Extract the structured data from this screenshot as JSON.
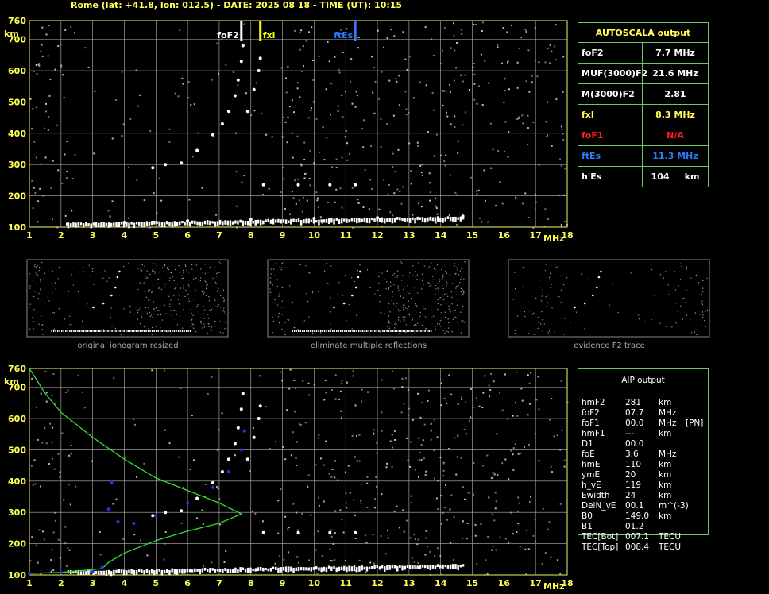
{
  "header": "Rome (lat: +41.8, lon: 012.5) - DATE: 2025 08 18 - TIME (UT): 10:15",
  "colors": {
    "grid": "#b8b8b8",
    "frame": "#cccc55",
    "accent": "#ffff55",
    "trace": "#ffffff",
    "profile_green": "#33dd33",
    "profile_blue": "#2233ff",
    "fxl": "#ffff00",
    "ftEs": "#2a7cff",
    "foF1": "#ff2020",
    "table_border": "#6cc66c"
  },
  "chart_data": [
    {
      "type": "scatter",
      "name": "ionogram-top",
      "xlabel": "MHz",
      "ylabel": "km",
      "xlim": [
        1,
        18
      ],
      "ylim": [
        100,
        760
      ],
      "xticks": [
        "1",
        "2",
        "3",
        "4",
        "5",
        "6",
        "7",
        "8",
        "9",
        "10",
        "11",
        "12",
        "13",
        "14",
        "15",
        "16",
        "17",
        "18"
      ],
      "yticks": [
        "100",
        "200",
        "300",
        "400",
        "500",
        "600",
        "700",
        "760"
      ],
      "grid": true,
      "markers": [
        {
          "label": "foF2",
          "x": 7.7,
          "color": "#ffffff"
        },
        {
          "label": "fxl",
          "x": 8.3,
          "color": "#ffff00"
        },
        {
          "label": "ftEs",
          "x": 11.3,
          "color": "#2a7cff"
        }
      ],
      "traces": {
        "F2": [
          [
            4.9,
            290
          ],
          [
            5.3,
            300
          ],
          [
            5.8,
            305
          ],
          [
            6.3,
            345
          ],
          [
            6.8,
            395
          ],
          [
            7.1,
            430
          ],
          [
            7.3,
            470
          ],
          [
            7.5,
            520
          ],
          [
            7.6,
            570
          ],
          [
            7.7,
            630
          ],
          [
            7.75,
            680
          ]
        ],
        "F2_x": [
          [
            7.9,
            470
          ],
          [
            8.1,
            540
          ],
          [
            8.25,
            600
          ],
          [
            8.3,
            640
          ]
        ],
        "E": [
          [
            2.2,
            110
          ],
          [
            4,
            115
          ],
          [
            6,
            120
          ],
          [
            8,
            125
          ],
          [
            10,
            128
          ],
          [
            12,
            130
          ],
          [
            14.7,
            135
          ]
        ],
        "Es": [
          [
            8.4,
            235
          ],
          [
            9.5,
            235
          ],
          [
            10.5,
            235
          ],
          [
            11.3,
            235
          ]
        ]
      }
    },
    {
      "type": "scatter",
      "name": "ionogram-bottom",
      "xlabel": "MHz",
      "ylabel": "km",
      "xlim": [
        1,
        18
      ],
      "ylim": [
        100,
        760
      ],
      "xticks": [
        "1",
        "2",
        "3",
        "4",
        "5",
        "6",
        "7",
        "8",
        "9",
        "10",
        "11",
        "12",
        "13",
        "14",
        "15",
        "16",
        "17",
        "18"
      ],
      "yticks": [
        "100",
        "200",
        "300",
        "400",
        "500",
        "600",
        "700",
        "760"
      ],
      "grid": true,
      "profiles": {
        "green_true_height": [
          [
            1,
            760
          ],
          [
            1.5,
            680
          ],
          [
            2,
            620
          ],
          [
            3,
            540
          ],
          [
            4,
            470
          ],
          [
            5,
            410
          ],
          [
            6,
            370
          ],
          [
            7,
            330
          ],
          [
            7.7,
            295
          ],
          [
            7,
            265
          ],
          [
            6,
            240
          ],
          [
            5,
            210
          ],
          [
            4,
            170
          ],
          [
            3.5,
            140
          ],
          [
            3.3,
            120
          ],
          [
            2,
            108
          ],
          [
            1,
            105
          ]
        ],
        "blue_virtual": [
          [
            3.6,
            395
          ],
          [
            3.5,
            310
          ],
          [
            3.8,
            270
          ],
          [
            4.3,
            265
          ],
          [
            5,
            290
          ],
          [
            6,
            330
          ],
          [
            6.8,
            380
          ],
          [
            7.3,
            430
          ],
          [
            7.7,
            500
          ],
          [
            7.8,
            560
          ],
          [
            1,
            105
          ],
          [
            2,
            108
          ],
          [
            3,
            110
          ],
          [
            3.3,
            125
          ]
        ]
      }
    }
  ],
  "autoscala": {
    "title": "AUTOSCALA output",
    "rows": [
      {
        "label": "foF2",
        "value": "7.7 MHz",
        "color": "#ffffff"
      },
      {
        "label": "MUF(3000)F2",
        "value": "21.6 MHz",
        "color": "#ffffff"
      },
      {
        "label": "M(3000)F2",
        "value": "2.81",
        "color": "#ffffff"
      },
      {
        "label": "fxl",
        "value": "8.3 MHz",
        "color": "#ffff55"
      },
      {
        "label": "foF1",
        "value": "N/A",
        "color": "#ff2020"
      },
      {
        "label": "ftEs",
        "value": "11.3 MHz",
        "color": "#2a7cff"
      },
      {
        "label": "h'Es",
        "value": "104     km",
        "color": "#ffffff"
      }
    ]
  },
  "thumbs": [
    {
      "caption": "original ionogram resized"
    },
    {
      "caption": "eliminate multiple reflections"
    },
    {
      "caption": "evidence F2 trace"
    }
  ],
  "aip": {
    "title": "AIP output",
    "rows": [
      [
        "hmF2",
        "281",
        "km",
        ""
      ],
      [
        "foF2",
        "07.7",
        "MHz",
        ""
      ],
      [
        "foF1",
        "00.0",
        "MHz",
        "[PN]"
      ],
      [
        "hmF1",
        "---",
        "km",
        ""
      ],
      [
        "D1",
        "00.0",
        "",
        ""
      ],
      [
        "foE",
        "3.6",
        "MHz",
        ""
      ],
      [
        "hmE",
        "110",
        "km",
        ""
      ],
      [
        "ymE",
        "20",
        "km",
        ""
      ],
      [
        "h_vE",
        "119",
        "km",
        ""
      ],
      [
        "Ewidth",
        "24",
        "km",
        ""
      ],
      [
        "DelN_vE",
        "00.1",
        "m^(-3)",
        ""
      ],
      [
        "B0",
        "149.0",
        "km",
        ""
      ],
      [
        "B1",
        "01.2",
        "",
        ""
      ],
      [
        "TEC[Bot]",
        "007.1",
        "TECU",
        ""
      ],
      [
        "TEC[Top]",
        "008.4",
        "TECU",
        ""
      ]
    ]
  }
}
